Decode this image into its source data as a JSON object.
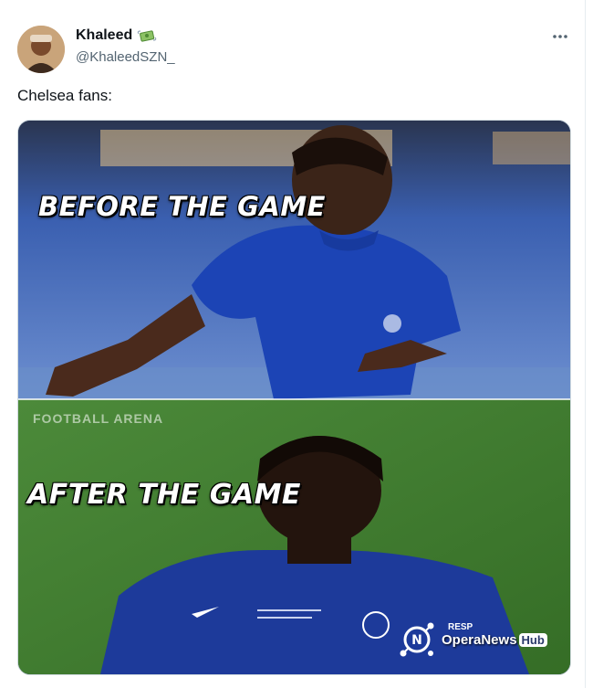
{
  "author": {
    "display_name": "Khaleed",
    "badge_icon": "money-with-wings-icon",
    "handle": "@KhaleedSZN_"
  },
  "tweet": {
    "text": "Chelsea fans:"
  },
  "meme": {
    "top_caption": "BEFORE THE GAME",
    "bottom_caption": "AFTER THE GAME",
    "watermark_top": "FOOTBALL ARENA",
    "watermark_bottom_brand": "OperaNews",
    "watermark_bottom_hub": "Hub",
    "small_tag": "RESP"
  },
  "colors": {
    "text_primary": "#0f1419",
    "text_secondary": "#536471",
    "border": "#cfd9de",
    "jersey_blue": "#1c44b5",
    "pitch_green": "#3f7a2d"
  }
}
